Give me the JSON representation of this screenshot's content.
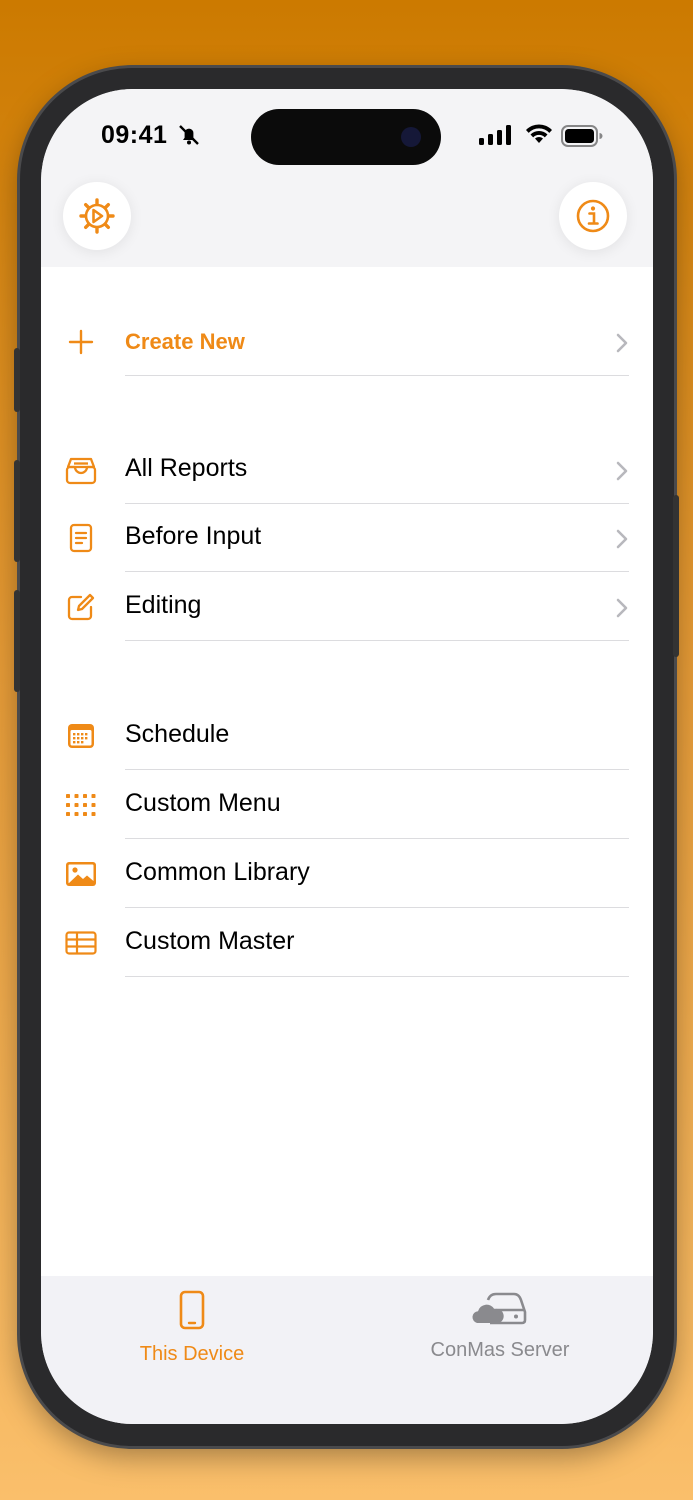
{
  "status": {
    "time": "09:41"
  },
  "icons": {
    "settings": "gear-play-icon",
    "info": "info-circle-icon",
    "create": "plus-icon",
    "all_reports": "tray-icon",
    "before_input": "document-icon",
    "editing": "pencil-square-icon",
    "schedule": "calendar-icon",
    "custom_menu": "grid-icon",
    "common_library": "photo-icon",
    "custom_master": "table-icon",
    "this_device": "phone-icon",
    "server": "cloud-drive-icon"
  },
  "colors": {
    "accent": "#ef8a17",
    "inactive": "#8a8a8e"
  },
  "menu": {
    "create_new": "Create New",
    "section1": [
      {
        "label": "All Reports"
      },
      {
        "label": "Before Input"
      },
      {
        "label": "Editing"
      }
    ],
    "section2": [
      {
        "label": "Schedule"
      },
      {
        "label": "Custom Menu"
      },
      {
        "label": "Common Library"
      },
      {
        "label": "Custom Master"
      }
    ]
  },
  "tabs": [
    {
      "label": "This Device",
      "active": true
    },
    {
      "label": "ConMas Server",
      "active": false
    }
  ]
}
